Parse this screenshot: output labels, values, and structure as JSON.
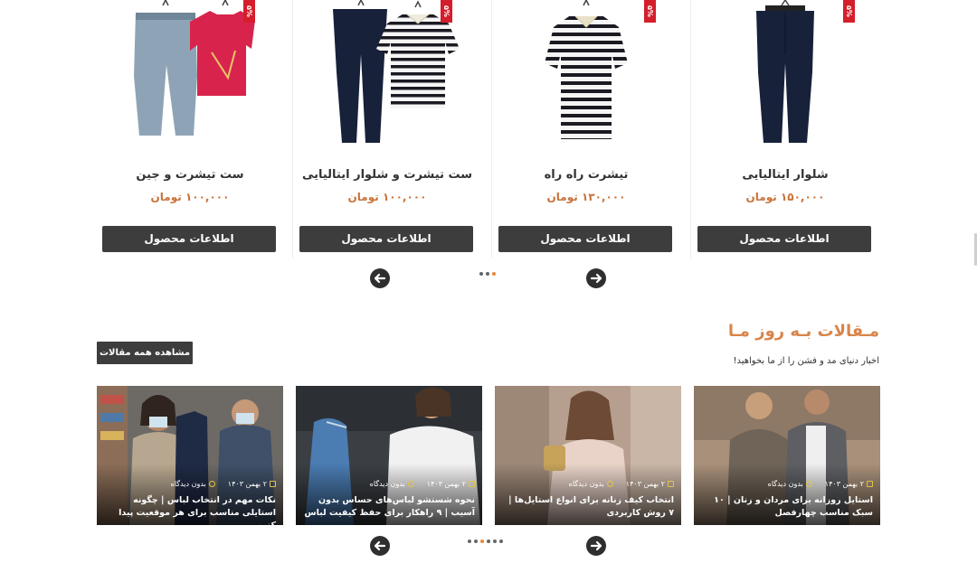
{
  "products": [
    {
      "title": "شلوار ایتالیایی",
      "price": "۱۵۰,۰۰۰ تومان",
      "button": "اطلاعات محصول",
      "tag": "۵%"
    },
    {
      "title": "تیشرت راه راه",
      "price": "۱۳۰,۰۰۰ تومان",
      "button": "اطلاعات محصول",
      "tag": "۵%"
    },
    {
      "title": "ست تیشرت و شلوار ایتالیایی",
      "price": "۱۰۰,۰۰۰ تومان",
      "button": "اطلاعات محصول",
      "tag": "۵%"
    },
    {
      "title": "ست تیشرت و جین",
      "price": "۱۰۰,۰۰۰ تومان",
      "button": "اطلاعات محصول",
      "tag": "۵%"
    }
  ],
  "products_nav": {
    "prev_icon": "arrow-right-icon",
    "next_icon": "arrow-left-icon",
    "dot_count": 3,
    "active_dot": 2
  },
  "articles_section": {
    "title": "مـقالات بـه روز مـا",
    "subtitle": "اخبار دنیای مد و فشن را از ما بخواهید!",
    "view_all": "مشاهده همه مقالات"
  },
  "articles": [
    {
      "date": "۲ بهمن ۱۴۰۳",
      "comments": "بدون دیدگاه",
      "title": "استایل روزانه برای مردان و زنان | ۱۰ سبک مناسب چهارفصل"
    },
    {
      "date": "۲ بهمن ۱۴۰۳",
      "comments": "بدون دیدگاه",
      "title": "انتخاب کیف زنانه برای انواع استایل‌ها | ۷ روش کاربردی"
    },
    {
      "date": "۲ بهمن ۱۴۰۳",
      "comments": "بدون دیدگاه",
      "title": "نحوه شستشو لباس‌های حساس بدون آسیب | ۹ راهکار برای حفظ کیفیت لباس"
    },
    {
      "date": "۲ بهمن ۱۴۰۳",
      "comments": "بدون دیدگاه",
      "title": "نکات مهم در انتخاب لباس | چگونه استایلی مناسب برای هر موقعیت پیدا کنیم"
    }
  ],
  "articles_nav": {
    "dot_count": 6,
    "active_dot": 2
  },
  "colors": {
    "accent": "#d8854b",
    "price": "#c8723a",
    "button": "#3d3d3d",
    "sale": "#d41e2b"
  }
}
